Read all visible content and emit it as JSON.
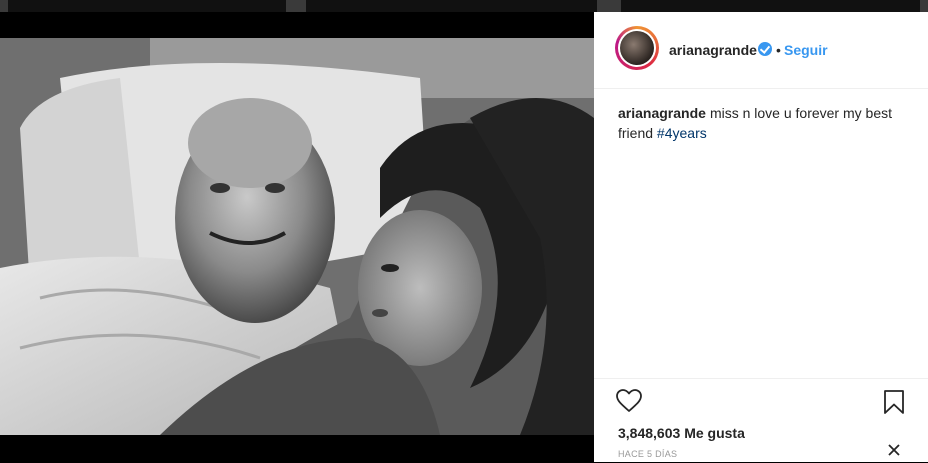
{
  "post": {
    "username": "arianagrande",
    "dot": "•",
    "follow_label": "Seguir",
    "caption_user": "arianagrande",
    "caption_text": "miss n love u forever my best friend ",
    "hashtag": "#4years",
    "likes_count": "3,848,603",
    "likes_label": "Me gusta",
    "timestamp": "HACE 5 DÍAS"
  },
  "icons": {
    "verified": "verified-badge-icon",
    "like": "heart-icon",
    "save": "bookmark-icon",
    "close": "close-icon"
  },
  "colors": {
    "link_blue": "#3897f0",
    "hashtag": "#003569",
    "text": "#262626",
    "muted": "#999999"
  }
}
